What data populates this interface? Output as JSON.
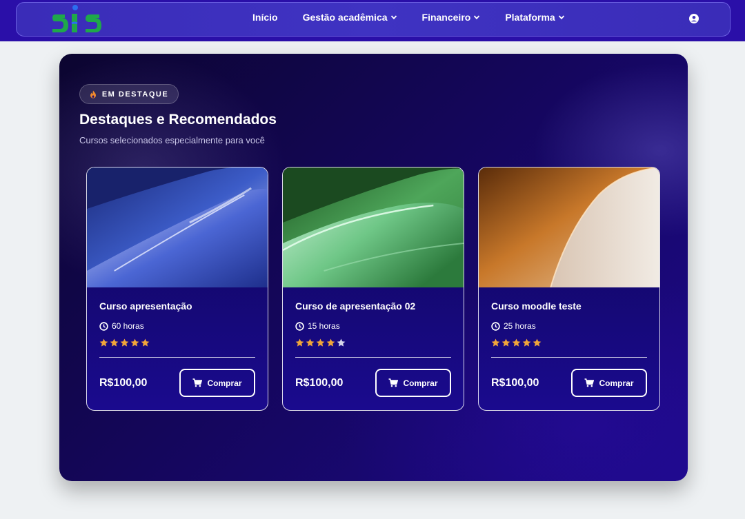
{
  "nav": {
    "links": [
      {
        "label": "Início",
        "dropdown": false
      },
      {
        "label": "Gestão acadêmica",
        "dropdown": true
      },
      {
        "label": "Financeiro",
        "dropdown": true
      },
      {
        "label": "Plataforma",
        "dropdown": true
      }
    ],
    "logo_colors": {
      "primary": "#1fa84a",
      "accent": "#2b6ef0"
    }
  },
  "hero": {
    "badge": "EM DESTAQUE",
    "badge_icon": "fire-icon",
    "title": "Destaques e Recomendados",
    "subtitle": "Cursos selecionados especialmente para você"
  },
  "courses": [
    {
      "title": "Curso apresentação",
      "hours": "60 horas",
      "rating": 5,
      "price": "R$100,00",
      "buy_label": "Comprar",
      "theme": "blue"
    },
    {
      "title": "Curso de apresentação 02",
      "hours": "15 horas",
      "rating": 4,
      "price": "R$100,00",
      "buy_label": "Comprar",
      "theme": "green"
    },
    {
      "title": "Curso moodle teste",
      "hours": "25 horas",
      "rating": 5,
      "price": "R$100,00",
      "buy_label": "Comprar",
      "theme": "amber"
    }
  ],
  "colors": {
    "nav_bg": "#2a0fa8",
    "star_on": "#f0a53a",
    "star_off": "#d7d6ea"
  }
}
